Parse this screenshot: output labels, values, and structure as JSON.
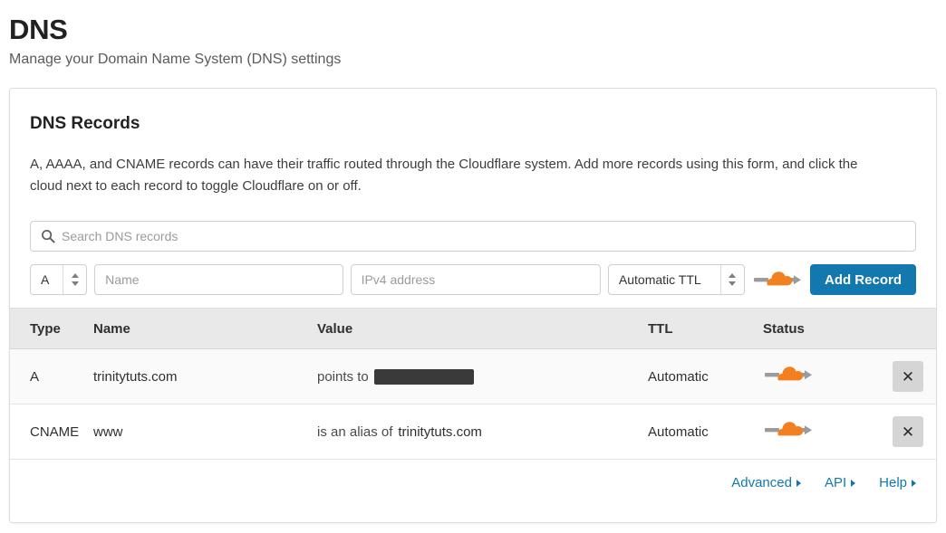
{
  "page": {
    "title": "DNS",
    "subtitle": "Manage your Domain Name System (DNS) settings"
  },
  "card": {
    "title": "DNS Records",
    "description": "A, AAAA, and CNAME records can have their traffic routed through the Cloudflare system. Add more records using this form, and click the cloud next to each record to toggle Cloudflare on or off."
  },
  "search": {
    "placeholder": "Search DNS records",
    "value": "",
    "icon": "search-icon"
  },
  "form": {
    "type_value": "A",
    "name_placeholder": "Name",
    "name_value": "",
    "value_placeholder": "IPv4 address",
    "value_value": "",
    "ttl_value": "Automatic TTL",
    "proxy_icon": "cloud-proxied-icon",
    "add_label": "Add Record"
  },
  "table": {
    "columns": [
      "Type",
      "Name",
      "Value",
      "TTL",
      "Status"
    ],
    "rows": [
      {
        "type": "A",
        "name": "trinitytuts.com",
        "value_prefix": "points to",
        "value_target": "",
        "value_redacted": true,
        "ttl": "Automatic",
        "status_icon": "cloud-proxied-icon",
        "delete_label": "✕"
      },
      {
        "type": "CNAME",
        "name": "www",
        "value_prefix": "is an alias of",
        "value_target": "trinitytuts.com",
        "value_redacted": false,
        "ttl": "Automatic",
        "status_icon": "cloud-proxied-icon",
        "delete_label": "✕"
      }
    ]
  },
  "footer": {
    "links": [
      {
        "label": "Advanced"
      },
      {
        "label": "API"
      },
      {
        "label": "Help"
      }
    ]
  },
  "colors": {
    "accent_blue": "#1278ad",
    "cloud_orange": "#f38020",
    "arrow_gray": "#9b9b9b",
    "header_band": "#e9e9e9",
    "redaction": "#3a3a3a"
  }
}
